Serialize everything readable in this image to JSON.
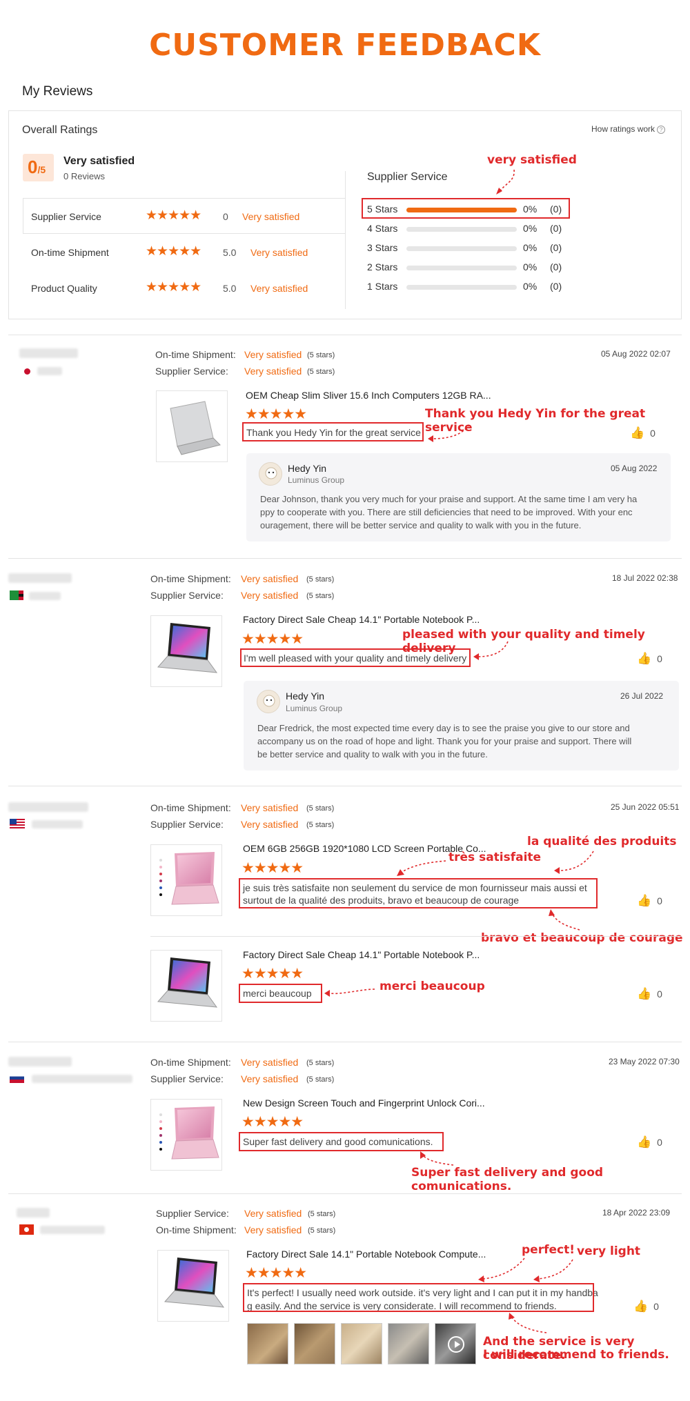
{
  "header": {
    "title": "CUSTOMER FEEDBACK",
    "my_reviews": "My Reviews"
  },
  "overall": {
    "label": "Overall Ratings",
    "how_ratings_work": "How ratings work",
    "score": "0",
    "score_of": "/5",
    "summary": "Very satisfied",
    "reviews_count": "0 Reviews",
    "ratings": [
      {
        "label": "Supplier Service",
        "stars": "★★★★★",
        "value": "0",
        "text": "Very satisfied"
      },
      {
        "label": "On-time Shipment",
        "stars": "★★★★★",
        "value": "5.0",
        "text": "Very satisfied"
      },
      {
        "label": "Product Quality",
        "stars": "★★★★★",
        "value": "5.0",
        "text": "Very satisfied"
      }
    ],
    "supplier_service_title": "Supplier Service",
    "bars": [
      {
        "label": "5  Stars",
        "fill": 1.0,
        "pct": "0%",
        "count": "(0)"
      },
      {
        "label": "4  Stars",
        "fill": 0,
        "pct": "0%",
        "count": "(0)"
      },
      {
        "label": "3  Stars",
        "fill": 0,
        "pct": "0%",
        "count": "(0)"
      },
      {
        "label": "2  Stars",
        "fill": 0,
        "pct": "0%",
        "count": "(0)"
      },
      {
        "label": "1  Stars",
        "fill": 0,
        "pct": "0%",
        "count": "(0)"
      }
    ],
    "annotation": "very satisfied"
  },
  "labels": {
    "ontime": "On-time Shipment:",
    "supplier": "Supplier Service:",
    "very_satisfied": "Very satisfied",
    "five_stars": "(5 stars)",
    "stars": "★★★★★",
    "like_count": "0",
    "thumb": "👍"
  },
  "reviews": [
    {
      "date": "05 Aug 2022 02:07",
      "product": "OEM Cheap Slim Sliver 15.6 Inch Computers 12GB RA...",
      "text": "Thank you Hedy Yin for the great service",
      "annotation": "Thank you Hedy Yin for the great service",
      "reply": {
        "name": "Hedy Yin",
        "org": "Luminus Group",
        "date": "05 Aug 2022",
        "lines": [
          "Dear Johnson, thank you very much for your praise and support. At the same time I am very ha",
          "ppy to cooperate with you. There are still deficiencies that need to be improved. With your enc",
          "ouragement, there will be better service and quality to walk with you in the future."
        ]
      }
    },
    {
      "date": "18 Jul 2022 02:38",
      "product": "Factory Direct Sale Cheap 14.1\" Portable Notebook P...",
      "text": "I'm well pleased with your quality and timely delivery",
      "annotation": "pleased with your quality and timely delivery",
      "reply": {
        "name": "Hedy Yin",
        "org": "Luminus Group",
        "date": "26 Jul 2022",
        "lines": [
          "Dear Fredrick, the most expected time every day is to see the praise you give to our store and",
          "accompany us on the road of hope and light. Thank you for your praise and support. There will",
          "be better service and quality to walk with you in the future."
        ]
      }
    },
    {
      "date": "25 Jun 2022 05:51",
      "product": "OEM 6GB 256GB 1920*1080 LCD Screen Portable Co...",
      "lines": [
        "je suis très satisfaite non seulement du service de mon fournisseur mais aussi et",
        "surtout de la qualité des produits, bravo et beaucoup de courage"
      ],
      "annotations": [
        "la qualité des produits",
        "très satisfaite",
        "bravo et beaucoup de courage"
      ],
      "second_product": "Factory Direct Sale Cheap 14.1\" Portable Notebook P...",
      "second_text": "merci beaucoup",
      "second_annotation": "merci beaucoup"
    },
    {
      "date": "23 May 2022 07:30",
      "product": "New Design Screen Touch and Fingerprint Unlock Cori...",
      "text": "Super fast delivery and good comunications.",
      "annotation": "Super fast delivery and good comunications."
    },
    {
      "date": "18 Apr 2022 23:09",
      "product": "Factory Direct Sale 14.1\" Portable Notebook Compute...",
      "lines": [
        "It's perfect! I usually need work outside. it's very light and I can put it in my handba",
        "g easily. And the service is very considerate. I will recommend to friends."
      ],
      "annotations": [
        "perfect!",
        "very light",
        "And the service is very considerate.",
        "I will recommend to friends."
      ]
    }
  ],
  "colors": {
    "accent": "#f06a12",
    "annotation": "#e0292b"
  }
}
